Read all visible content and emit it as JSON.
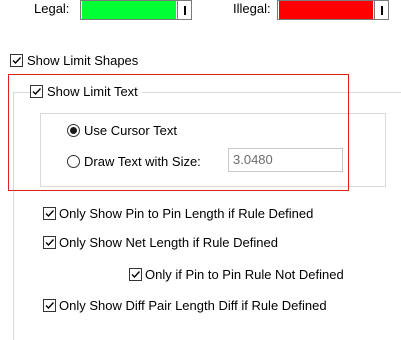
{
  "limits": {
    "legal_label": "Legal:",
    "legal_color": "#00ff33",
    "illegal_label": "Illegal:",
    "illegal_color": "#ff0000",
    "dropdown_icon": "chevron-down-icon"
  },
  "show_limit_shapes": {
    "label": "Show Limit Shapes",
    "checked": true
  },
  "show_limit_text": {
    "label": "Show Limit Text",
    "checked": true
  },
  "text_mode": {
    "use_cursor_text": {
      "label": "Use Cursor Text",
      "selected": true
    },
    "draw_text_with_size": {
      "label": "Draw Text with Size:",
      "selected": false
    },
    "size_value": "3.0480"
  },
  "options": {
    "pin_to_pin": {
      "label": "Only Show Pin to Pin Length if Rule Defined",
      "checked": true
    },
    "net_length": {
      "label": "Only Show Net Length if Rule Defined",
      "checked": true
    },
    "pin_rule_not_defined": {
      "label": "Only if Pin to Pin Rule Not Defined",
      "checked": true
    },
    "diff_pair": {
      "label": "Only Show Diff Pair Length Diff if Rule Defined",
      "checked": true
    }
  },
  "colors": {
    "highlight_border": "#e02020",
    "groupbox_border": "#d9d9d9"
  }
}
